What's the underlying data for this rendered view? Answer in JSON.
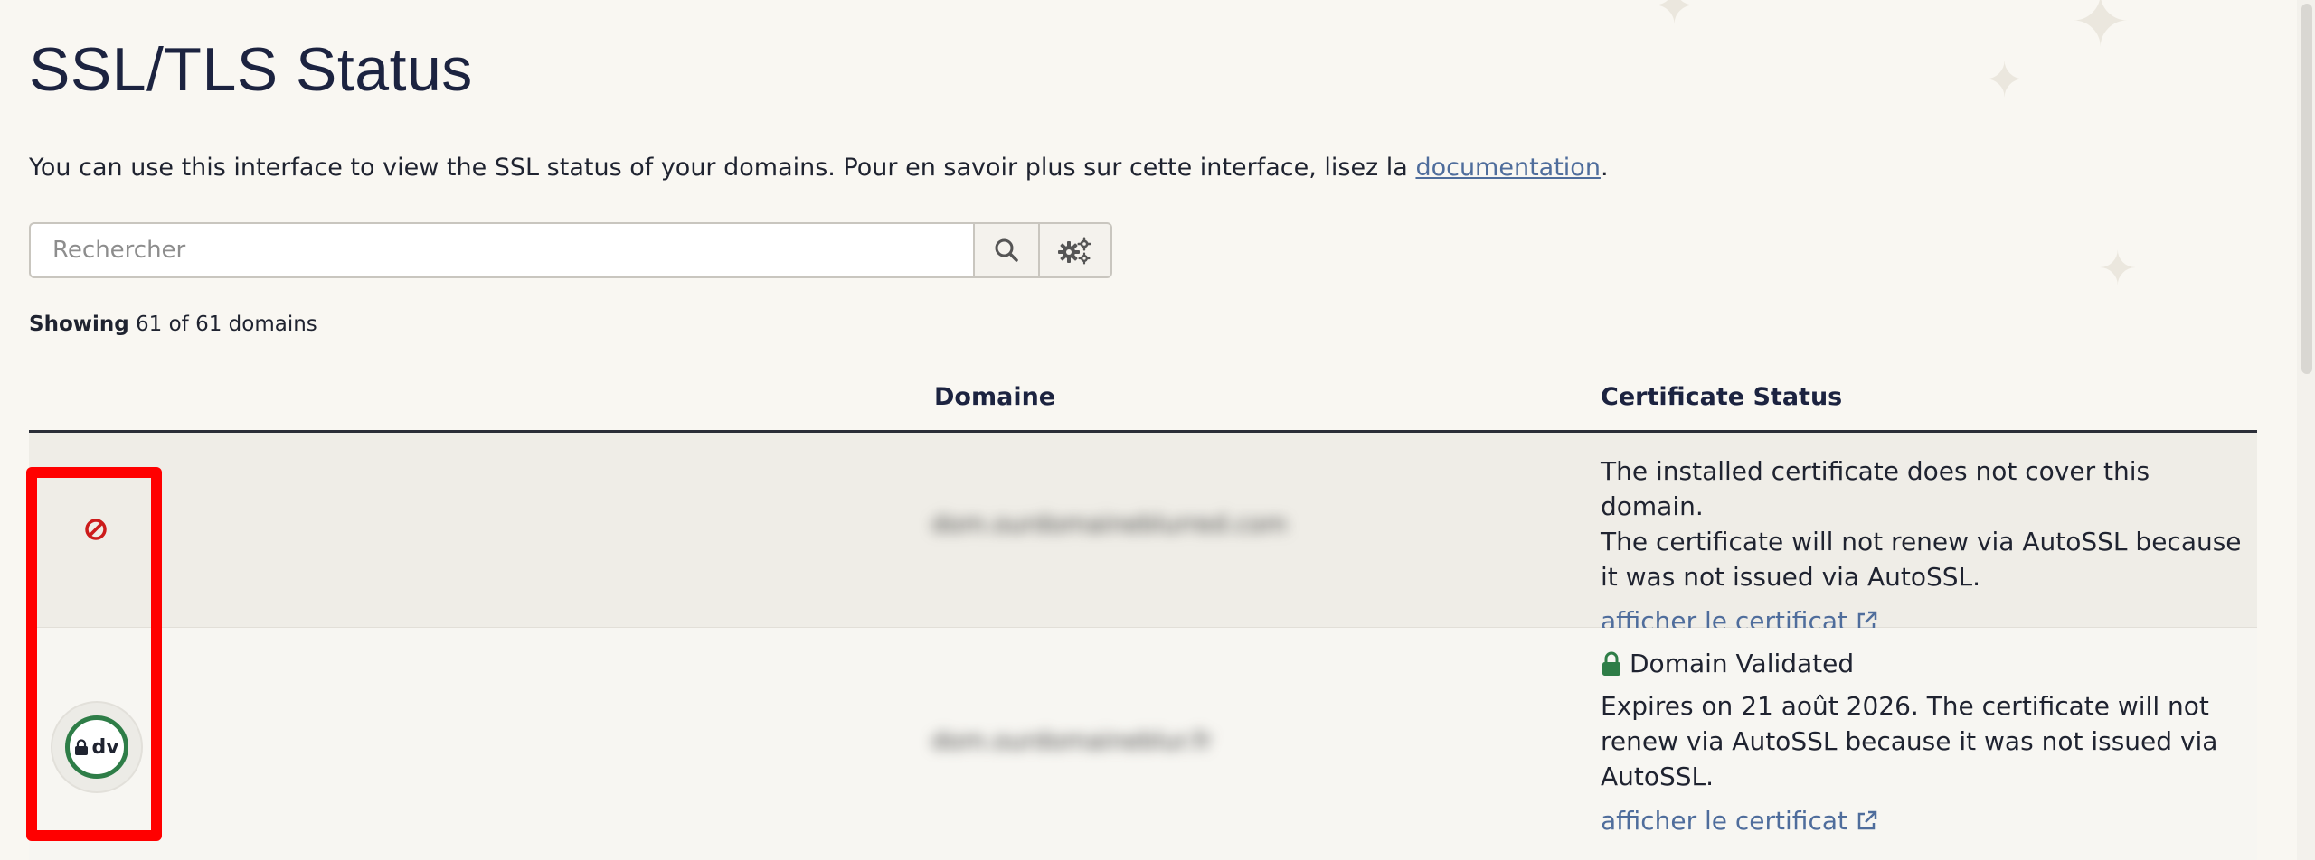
{
  "page": {
    "title": "SSL/TLS Status",
    "intro_text": "You can use this interface to view the SSL status of your domains. Pour en savoir plus sur cette interface, lisez la ",
    "intro_link": "documentation",
    "intro_end": "."
  },
  "search": {
    "placeholder": "Rechercher",
    "value": "",
    "search_icon": "search-icon",
    "settings_icon": "gears-icon"
  },
  "summary": {
    "bold": "Showing",
    "rest": " 61 of 61 domains"
  },
  "table": {
    "headers": {
      "domain": "Domaine",
      "status": "Certificate Status"
    },
    "rows": [
      {
        "icon": "ban-icon",
        "domain": "dom.ourdomaineblurred.com",
        "status_lines": [
          "The installed certificate does not cover this domain.",
          "The certificate will not renew via AutoSSL because",
          "it was not issued via AutoSSL."
        ],
        "link": "afficher le certificat"
      },
      {
        "icon": "dv-badge",
        "badge_text": "dv",
        "domain": "dom.ourdomaineblur.fr",
        "validated": "Domain Validated",
        "status_lines": [
          "Expires on 21 août 2026. The certificate will not",
          "renew via AutoSSL because it was not issued via",
          "AutoSSL."
        ],
        "link": "afficher le certificat"
      }
    ]
  },
  "colors": {
    "background": "#f9f7f2",
    "link": "#4f6d9c",
    "danger": "#cc1b1b",
    "success": "#2e7d47",
    "highlight": "#ff0000"
  }
}
